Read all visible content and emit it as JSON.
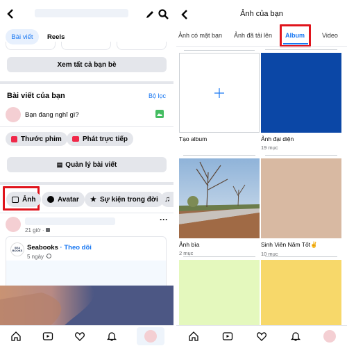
{
  "left": {
    "tabs": [
      "Bài viết",
      "Reels"
    ],
    "see_all_friends": "Xem tất cả bạn bè",
    "posts_heading": "Bài viết của bạn",
    "filter": "Bộ lọc",
    "composer_placeholder": "Bạn đang nghĩ gì?",
    "chips": [
      "Thước phim",
      "Phát trực tiếp"
    ],
    "manage_posts": "Quản lý bài viết",
    "categories": [
      "Ảnh",
      "Avatar",
      "Sự kiện trong đời"
    ],
    "post": {
      "time": "21 giờ ·",
      "shared_author": "Seabooks",
      "follow": "· Theo dõi",
      "shared_time": "5 ngày ·",
      "shared_logo": "SEA BOOKS"
    }
  },
  "right": {
    "title": "Ảnh của bạn",
    "tabs": [
      "Ảnh có mặt bạn",
      "Ảnh đã tải lên",
      "Album",
      "Video"
    ],
    "active_tab": "Album",
    "albums": [
      {
        "title": "Tạo album",
        "count": "",
        "thumb": "create"
      },
      {
        "title": "Ảnh đại diện",
        "count": "19 mục",
        "thumb": "#0b47a6"
      },
      {
        "title": "Ảnh bìa",
        "count": "2 mục",
        "thumb": "photo"
      },
      {
        "title": "Sinh Viên Năm Tốt✌",
        "count": "10 mục",
        "thumb": "#d8b9a2"
      },
      {
        "title": "",
        "count": "",
        "thumb": "#e4f8bd"
      },
      {
        "title": "",
        "count": "",
        "thumb": "#f7d86a"
      }
    ]
  },
  "colors": {
    "accent": "#1877f2",
    "highlight_box": "#e0141c",
    "divider": "#c9ccd1"
  },
  "icons": {
    "nav": [
      "home-icon",
      "video-icon",
      "heart-icon",
      "bell-icon",
      "profile-avatar"
    ],
    "left_header": [
      "back-arrow-icon",
      "pencil-icon",
      "search-icon"
    ],
    "right_header": [
      "back-arrow-icon"
    ]
  }
}
